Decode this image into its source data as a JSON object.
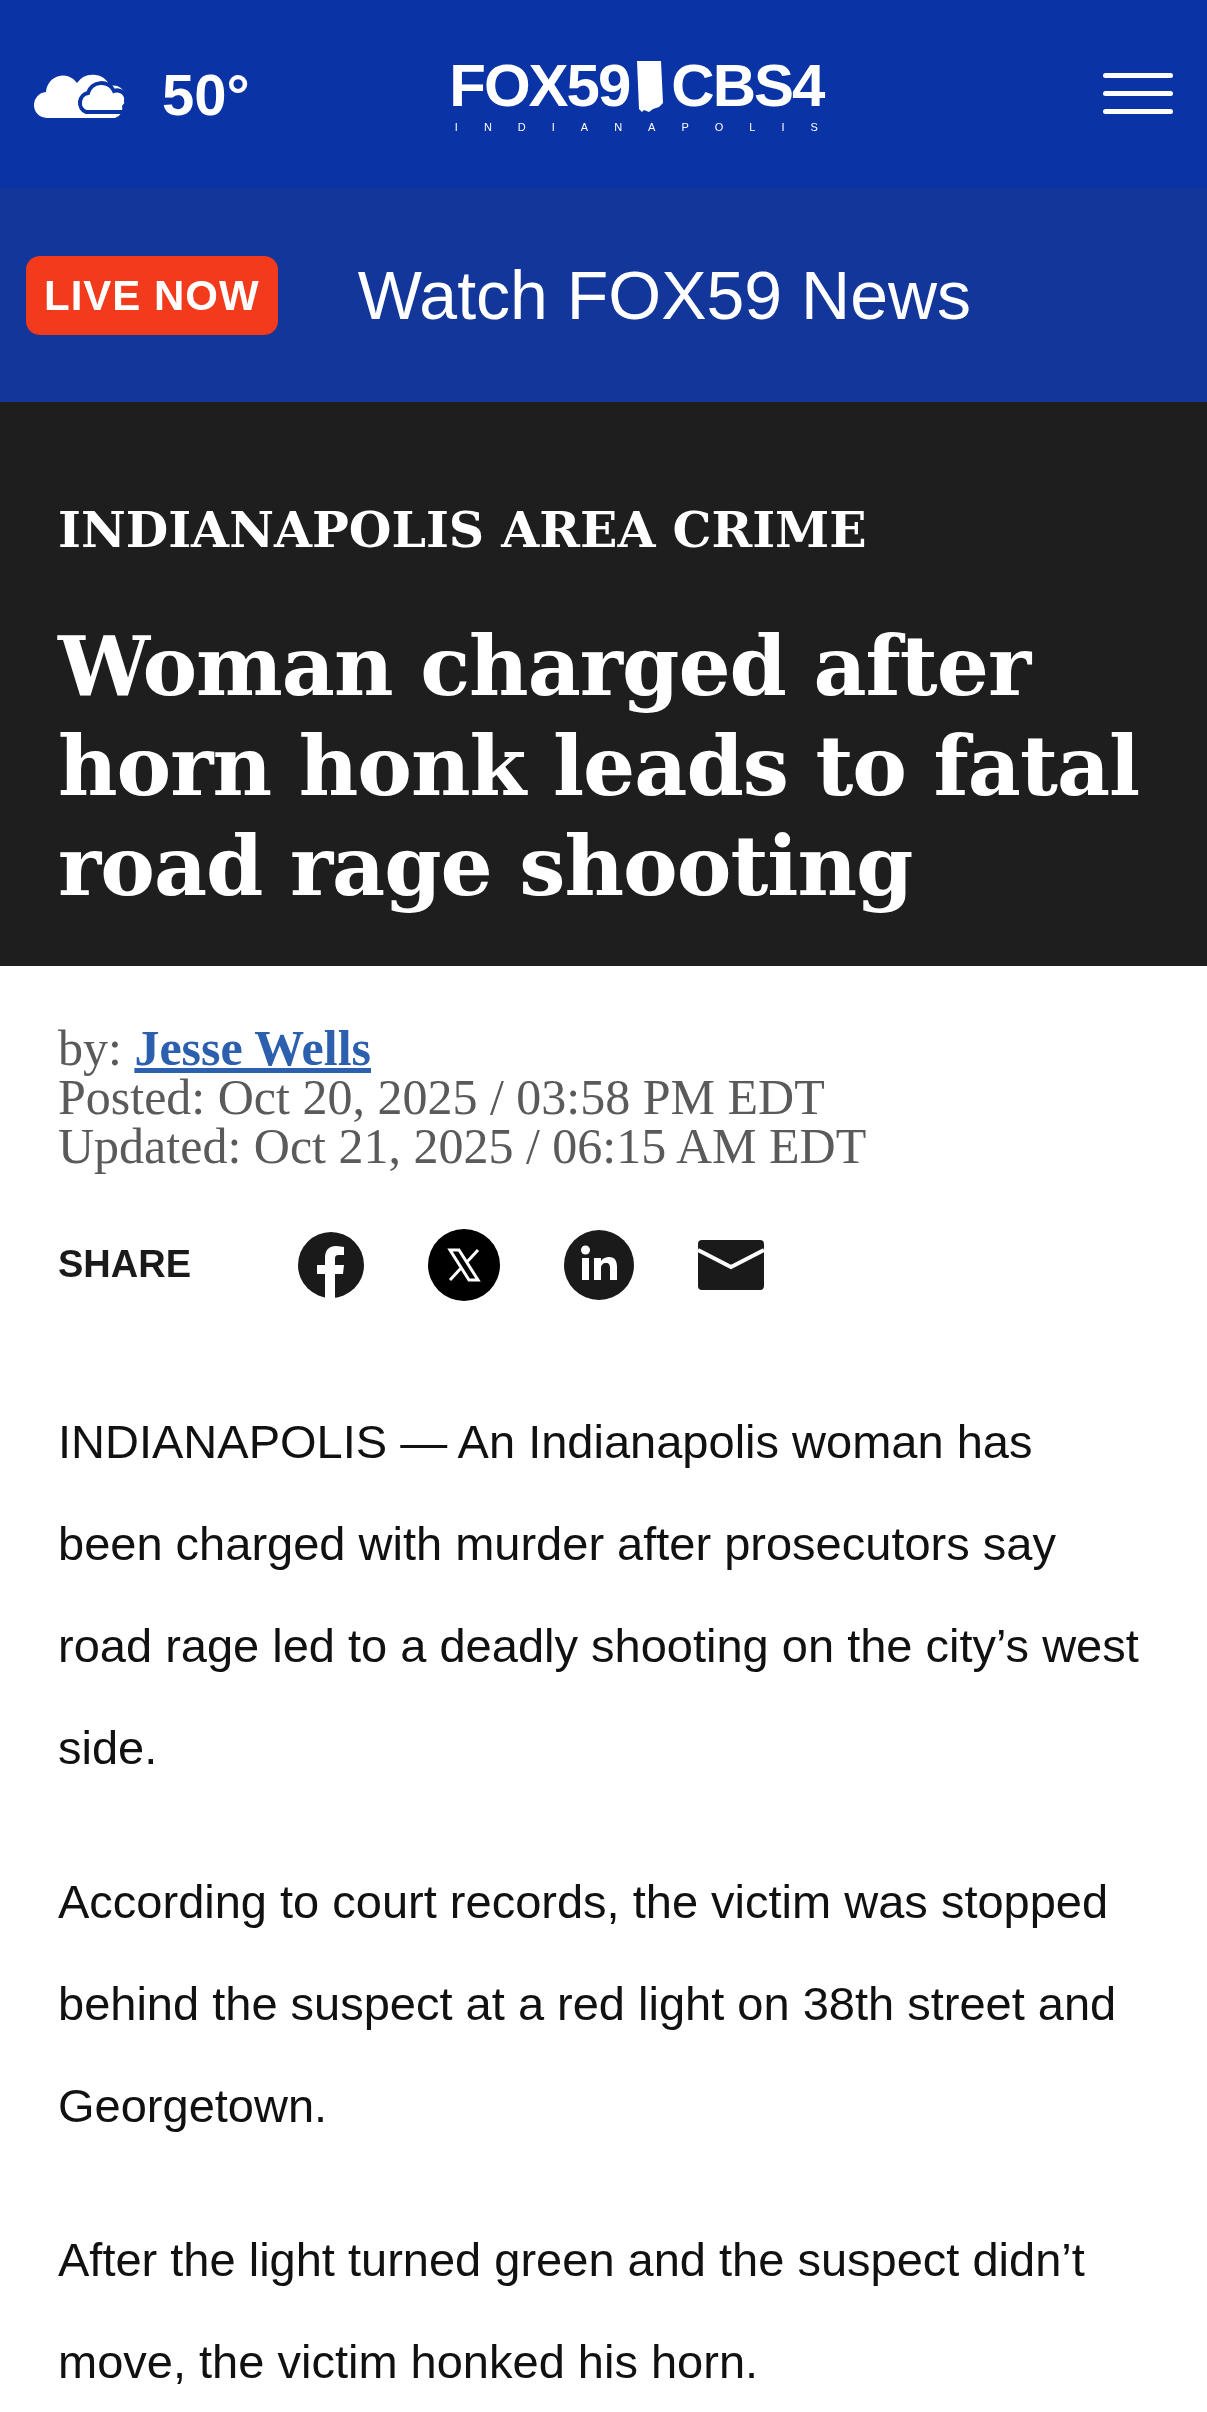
{
  "header": {
    "temperature": "50°",
    "logo": {
      "primary": "FOX59",
      "secondary": "CBS4",
      "city": "INDIANAPOLIS"
    }
  },
  "live_bar": {
    "badge": "LIVE NOW",
    "title": "Watch FOX59 News"
  },
  "article": {
    "category": "INDIANAPOLIS AREA CRIME",
    "headline": "Woman charged after horn honk leads to fatal road rage shooting",
    "byline": {
      "prefix": "by:",
      "author": "Jesse Wells"
    },
    "posted": "Posted: Oct 20, 2025 / 03:58 PM EDT",
    "updated": "Updated: Oct 21, 2025 / 06:15 AM EDT",
    "share": {
      "label": "SHARE",
      "buttons": [
        {
          "kind": "facebook"
        },
        {
          "kind": "x"
        },
        {
          "kind": "linkedin"
        },
        {
          "kind": "email"
        }
      ]
    },
    "paragraphs": [
      "INDIANAPOLIS — An Indianapolis woman has been charged with murder after prosecutors say road rage led to a deadly shooting on the city’s west side.",
      "According to court records, the victim was stopped behind the suspect at a red light on 38th street and Georgetown.",
      "After the light turned green and the suspect didn’t move, the victim honked his horn."
    ]
  }
}
